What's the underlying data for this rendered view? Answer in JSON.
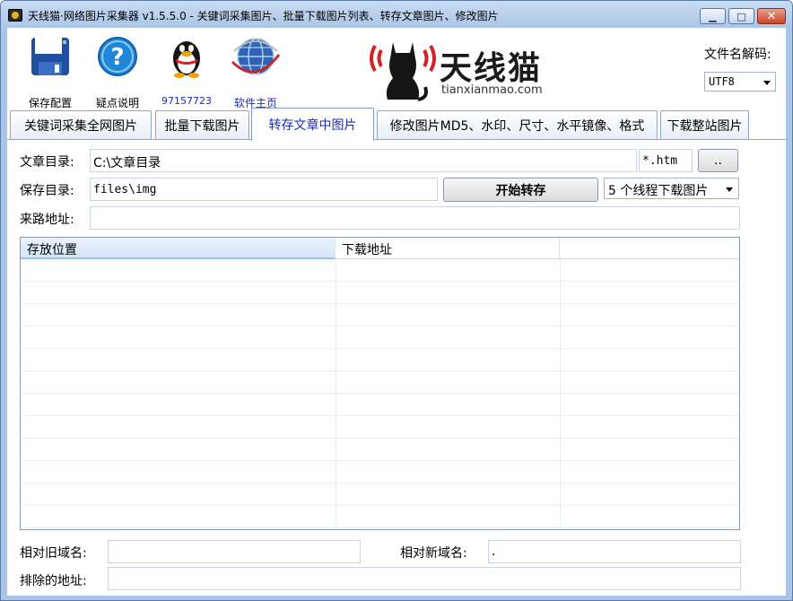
{
  "window": {
    "title": "天线猫·网络图片采集器 v1.5.5.0 - 关键词采集图片、批量下载图片列表、转存文章图片、修改图片"
  },
  "toolbar": {
    "save_config": "保存配置",
    "help": "疑点说明",
    "qq": "97157723",
    "homepage": "软件主页"
  },
  "logo": {
    "title": "天线猫",
    "subtitle": "tianxianmao.com"
  },
  "decode": {
    "label": "文件名解码:",
    "value": "UTF8"
  },
  "tabs": [
    {
      "label": "关键词采集全网图片",
      "active": false
    },
    {
      "label": "批量下载图片",
      "active": false
    },
    {
      "label": "转存文章中图片",
      "active": true
    },
    {
      "label": "修改图片MD5、水印、尺寸、水平镜像、格式",
      "active": false
    },
    {
      "label": "下载整站图片",
      "active": false
    }
  ],
  "form": {
    "article_dir_label": "文章目录:",
    "article_dir_value": "C:\\文章目录",
    "ext_value": "*.htm",
    "browse_label": "..",
    "save_dir_label": "保存目录:",
    "save_dir_value": "files\\img",
    "start_button": "开始转存",
    "threads_value": "5 个线程下载图片",
    "referer_label": "来路地址:",
    "referer_value": ""
  },
  "list": {
    "columns": [
      "存放位置",
      "下载地址",
      ""
    ]
  },
  "footer": {
    "old_domain_label": "相对旧域名:",
    "old_domain_value": "",
    "new_domain_label": "相对新域名:",
    "new_domain_value": ".",
    "exclude_label": "排除的地址:",
    "exclude_value": ""
  },
  "colors": {
    "title_bar": "#a8c4e6",
    "active_tab_text": "#1a2db8",
    "logo_red": "#d42222"
  }
}
